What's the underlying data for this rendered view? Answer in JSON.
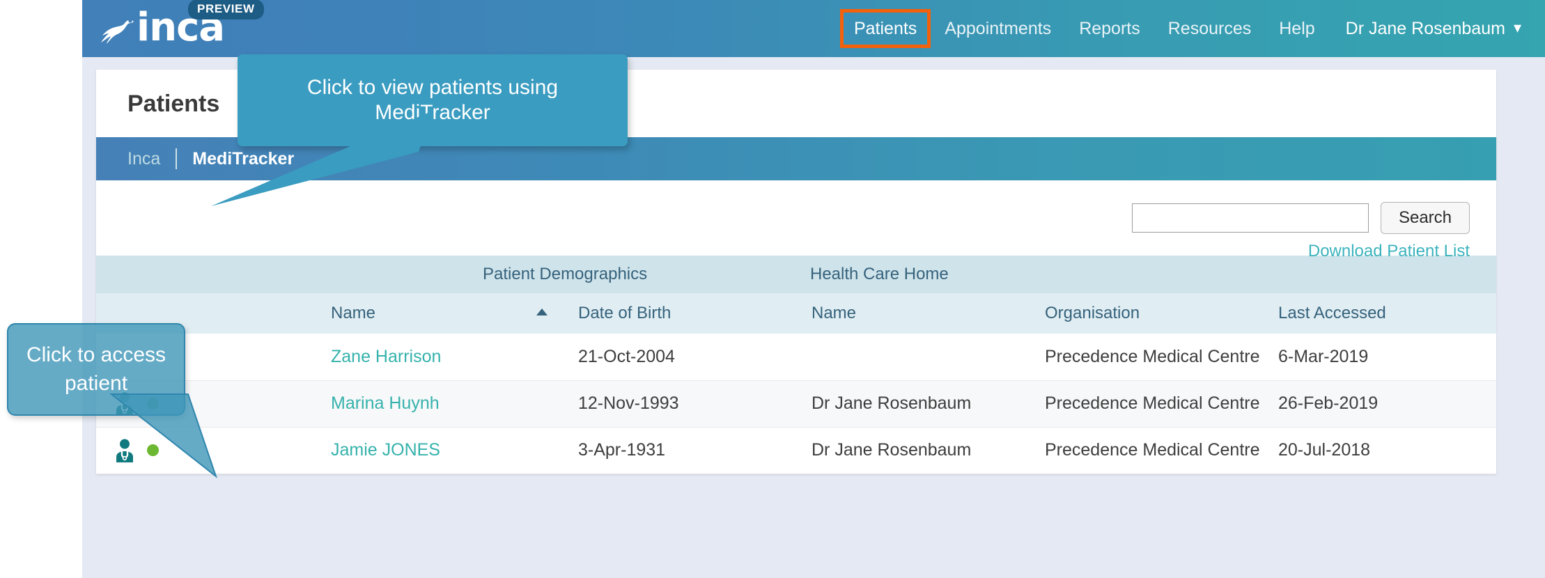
{
  "brand": {
    "logo_text": "inca",
    "preview_badge": "PREVIEW",
    "bird_icon": "bird-icon",
    "colors": {
      "header_left": "#4180b8",
      "header_right": "#35a5b0",
      "accent_teal": "#35b2ac",
      "highlight_orange": "#f4610b",
      "link_teal": "#3bb3bd",
      "status_green": "#6cb832"
    }
  },
  "nav": {
    "items": [
      {
        "label": "Patients",
        "active": true,
        "highlighted": true
      },
      {
        "label": "Appointments",
        "active": false,
        "highlighted": false
      },
      {
        "label": "Reports",
        "active": false,
        "highlighted": false
      },
      {
        "label": "Resources",
        "active": false,
        "highlighted": false
      },
      {
        "label": "Help",
        "active": false,
        "highlighted": false
      }
    ],
    "user": "Dr Jane Rosenbaum",
    "user_caret": "⌄"
  },
  "page": {
    "title": "Patients"
  },
  "subnav": {
    "items": [
      {
        "label": "Inca",
        "active": false
      },
      {
        "label": "MediTracker",
        "active": true
      }
    ]
  },
  "search": {
    "value": "",
    "placeholder": "",
    "button_label": "Search",
    "icon": "search-icon",
    "download_link": "Download Patient List"
  },
  "table": {
    "group_headers": [
      {
        "label": "",
        "span": 1
      },
      {
        "label": "Patient Demographics",
        "span": 2
      },
      {
        "label": "Health Care Home",
        "span": 3
      }
    ],
    "columns": [
      {
        "label": "",
        "key": "icon"
      },
      {
        "label": "Name",
        "key": "name",
        "sorted": "asc"
      },
      {
        "label": "Date of Birth",
        "key": "dob"
      },
      {
        "label": "Name",
        "key": "hch_name"
      },
      {
        "label": "Organisation",
        "key": "organisation"
      },
      {
        "label": "Last Accessed",
        "key": "last_accessed"
      }
    ],
    "rows": [
      {
        "has_icon": false,
        "has_status_dot": false,
        "name": "Zane Harrison",
        "dob": "21-Oct-2004",
        "hch_name": "",
        "organisation": "Precedence Medical Centre",
        "last_accessed": "6-Mar-2019"
      },
      {
        "has_icon": true,
        "has_status_dot": true,
        "name": "Marina Huynh",
        "dob": "12-Nov-1993",
        "hch_name": "Dr Jane Rosenbaum",
        "organisation": "Precedence Medical Centre",
        "last_accessed": "26-Feb-2019"
      },
      {
        "has_icon": true,
        "has_status_dot": true,
        "name": "Jamie JONES",
        "dob": "3-Apr-1931",
        "hch_name": "Dr Jane Rosenbaum",
        "organisation": "Precedence Medical Centre",
        "last_accessed": "20-Jul-2018"
      }
    ]
  },
  "callouts": {
    "meditracker": {
      "text": "Click to view patients using MediTracker"
    },
    "patient": {
      "text": "Click to access patient"
    }
  }
}
